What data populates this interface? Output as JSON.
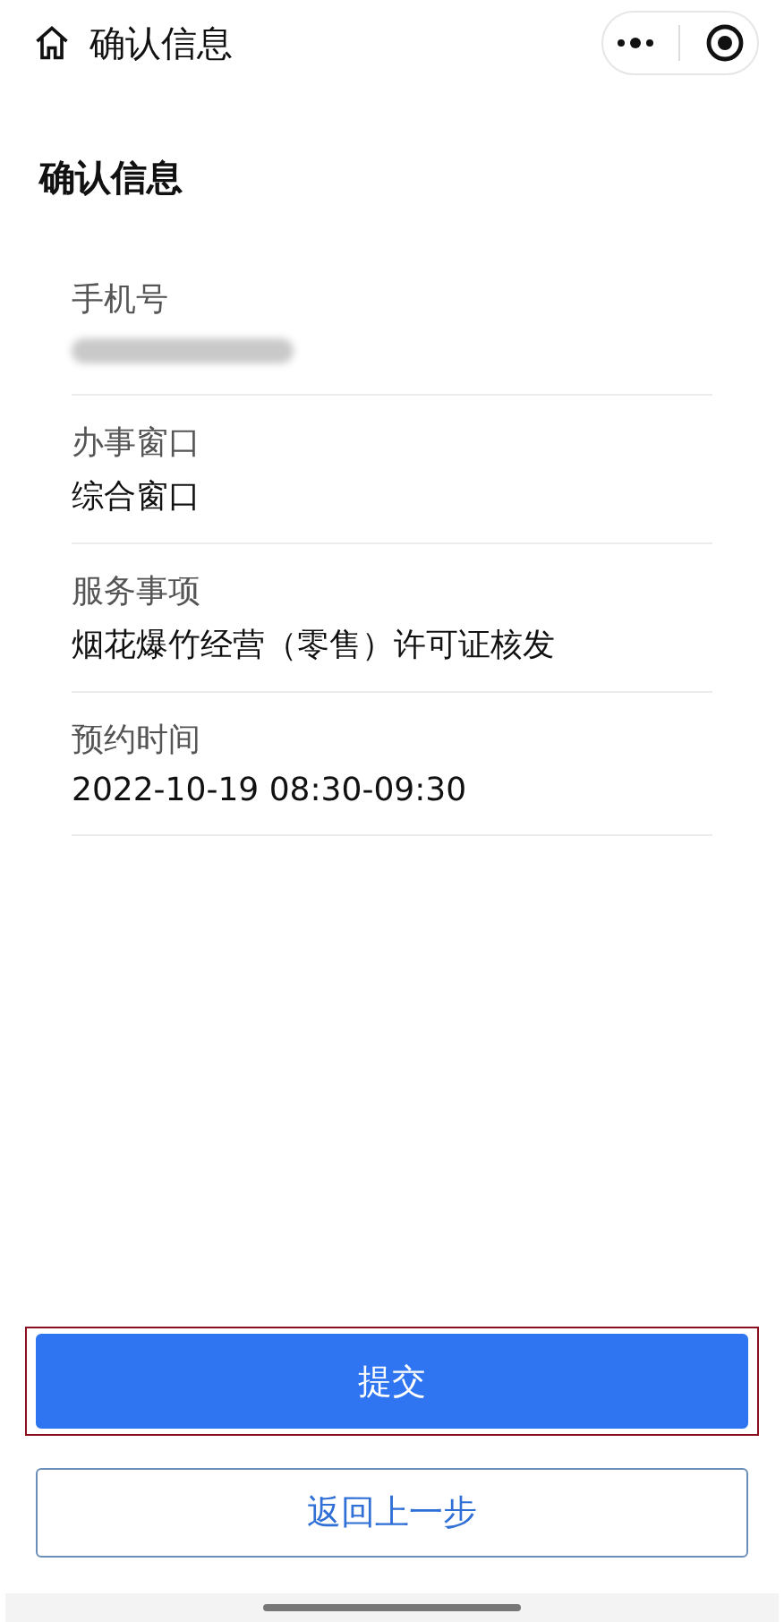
{
  "nav_bar": {
    "title": "确认信息"
  },
  "heading": "确认信息",
  "fields": [
    {
      "label": "手机号",
      "kind": "blurred"
    },
    {
      "label": "办事窗口",
      "kind": "text",
      "value": "综合窗口"
    },
    {
      "label": "服务事项",
      "kind": "text",
      "value": "烟花爆竹经营（零售）许可证核发"
    },
    {
      "label": "预约时间",
      "kind": "text",
      "value": "2022-10-19 08:30-09:30"
    }
  ],
  "buttons": [
    {
      "label": "提交",
      "kind": "primary",
      "highlighted": true
    },
    {
      "label": "返回上一步",
      "kind": "outline",
      "highlighted": false
    }
  ]
}
